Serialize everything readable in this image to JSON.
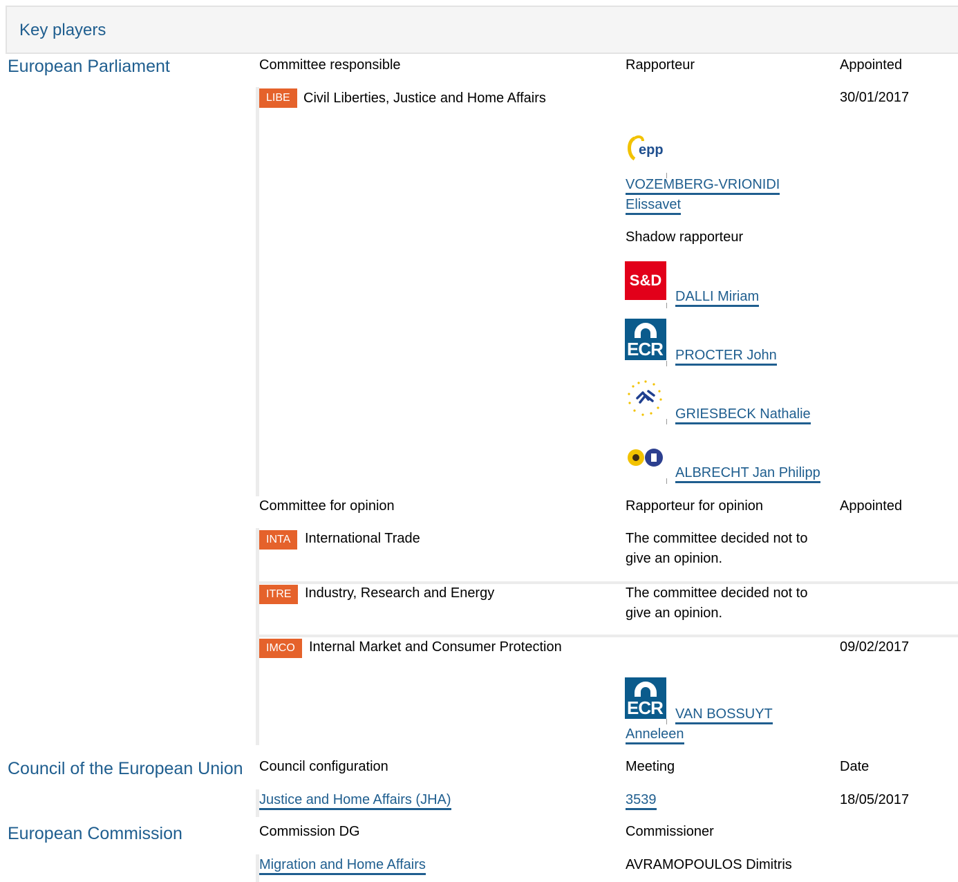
{
  "header": {
    "title": "Key players"
  },
  "institutions": {
    "ep": "European Parliament",
    "council": "Council of the European Union",
    "commission": "European Commission"
  },
  "ep": {
    "col_committee": "Committee responsible",
    "col_rapporteur": "Rapporteur",
    "col_appointed": "Appointed",
    "libe": {
      "code": "LIBE",
      "name": "Civil Liberties, Justice and Home Affairs",
      "date": "30/01/2017"
    },
    "rapporteur": {
      "group_icon": "epp-logo",
      "name_line1": "VOZEMBERG-VRIONIDI",
      "name_line2": "Elissavet"
    },
    "shadow_label": "Shadow rapporteur",
    "shadows": [
      {
        "group_icon": "sd-logo",
        "logo_text": "S&D",
        "name": "DALLI Miriam"
      },
      {
        "group_icon": "ecr-logo",
        "logo_text": "ECR",
        "name": "PROCTER John"
      },
      {
        "group_icon": "alde-logo",
        "name": "GRIESBECK Nathalie"
      },
      {
        "group_icon": "greens-efa-logo",
        "name": "ALBRECHT Jan Philipp"
      }
    ],
    "col_opinion": "Committee for opinion",
    "col_rapp_opinion": "Rapporteur for opinion",
    "col_appointed2": "Appointed",
    "inta": {
      "code": "INTA",
      "name": "International Trade",
      "note": "The committee decided not to give an opinion."
    },
    "itre": {
      "code": "ITRE",
      "name": "Industry, Research and Energy",
      "note": "The committee decided not to give an opinion."
    },
    "imco": {
      "code": "IMCO",
      "name": "Internal Market and Consumer Protection",
      "date": "09/02/2017"
    },
    "imco_rapporteur": {
      "group_icon": "ecr-logo",
      "logo_text": "ECR",
      "name_line1": "VAN BOSSUYT",
      "name_line2": "Anneleen"
    }
  },
  "council": {
    "col_config": "Council configuration",
    "col_meeting": "Meeting",
    "col_date": "Date",
    "config": "Justice and Home Affairs (JHA)",
    "meeting": "3539",
    "date": "18/05/2017"
  },
  "commission": {
    "col_dg": "Commission DG",
    "col_commissioner": "Commissioner",
    "dg": "Migration and Home Affairs",
    "commissioner": "AVRAMOPOULOS Dimitris"
  },
  "colors": {
    "link": "#1f5e8f",
    "badge": "#e5622b"
  }
}
